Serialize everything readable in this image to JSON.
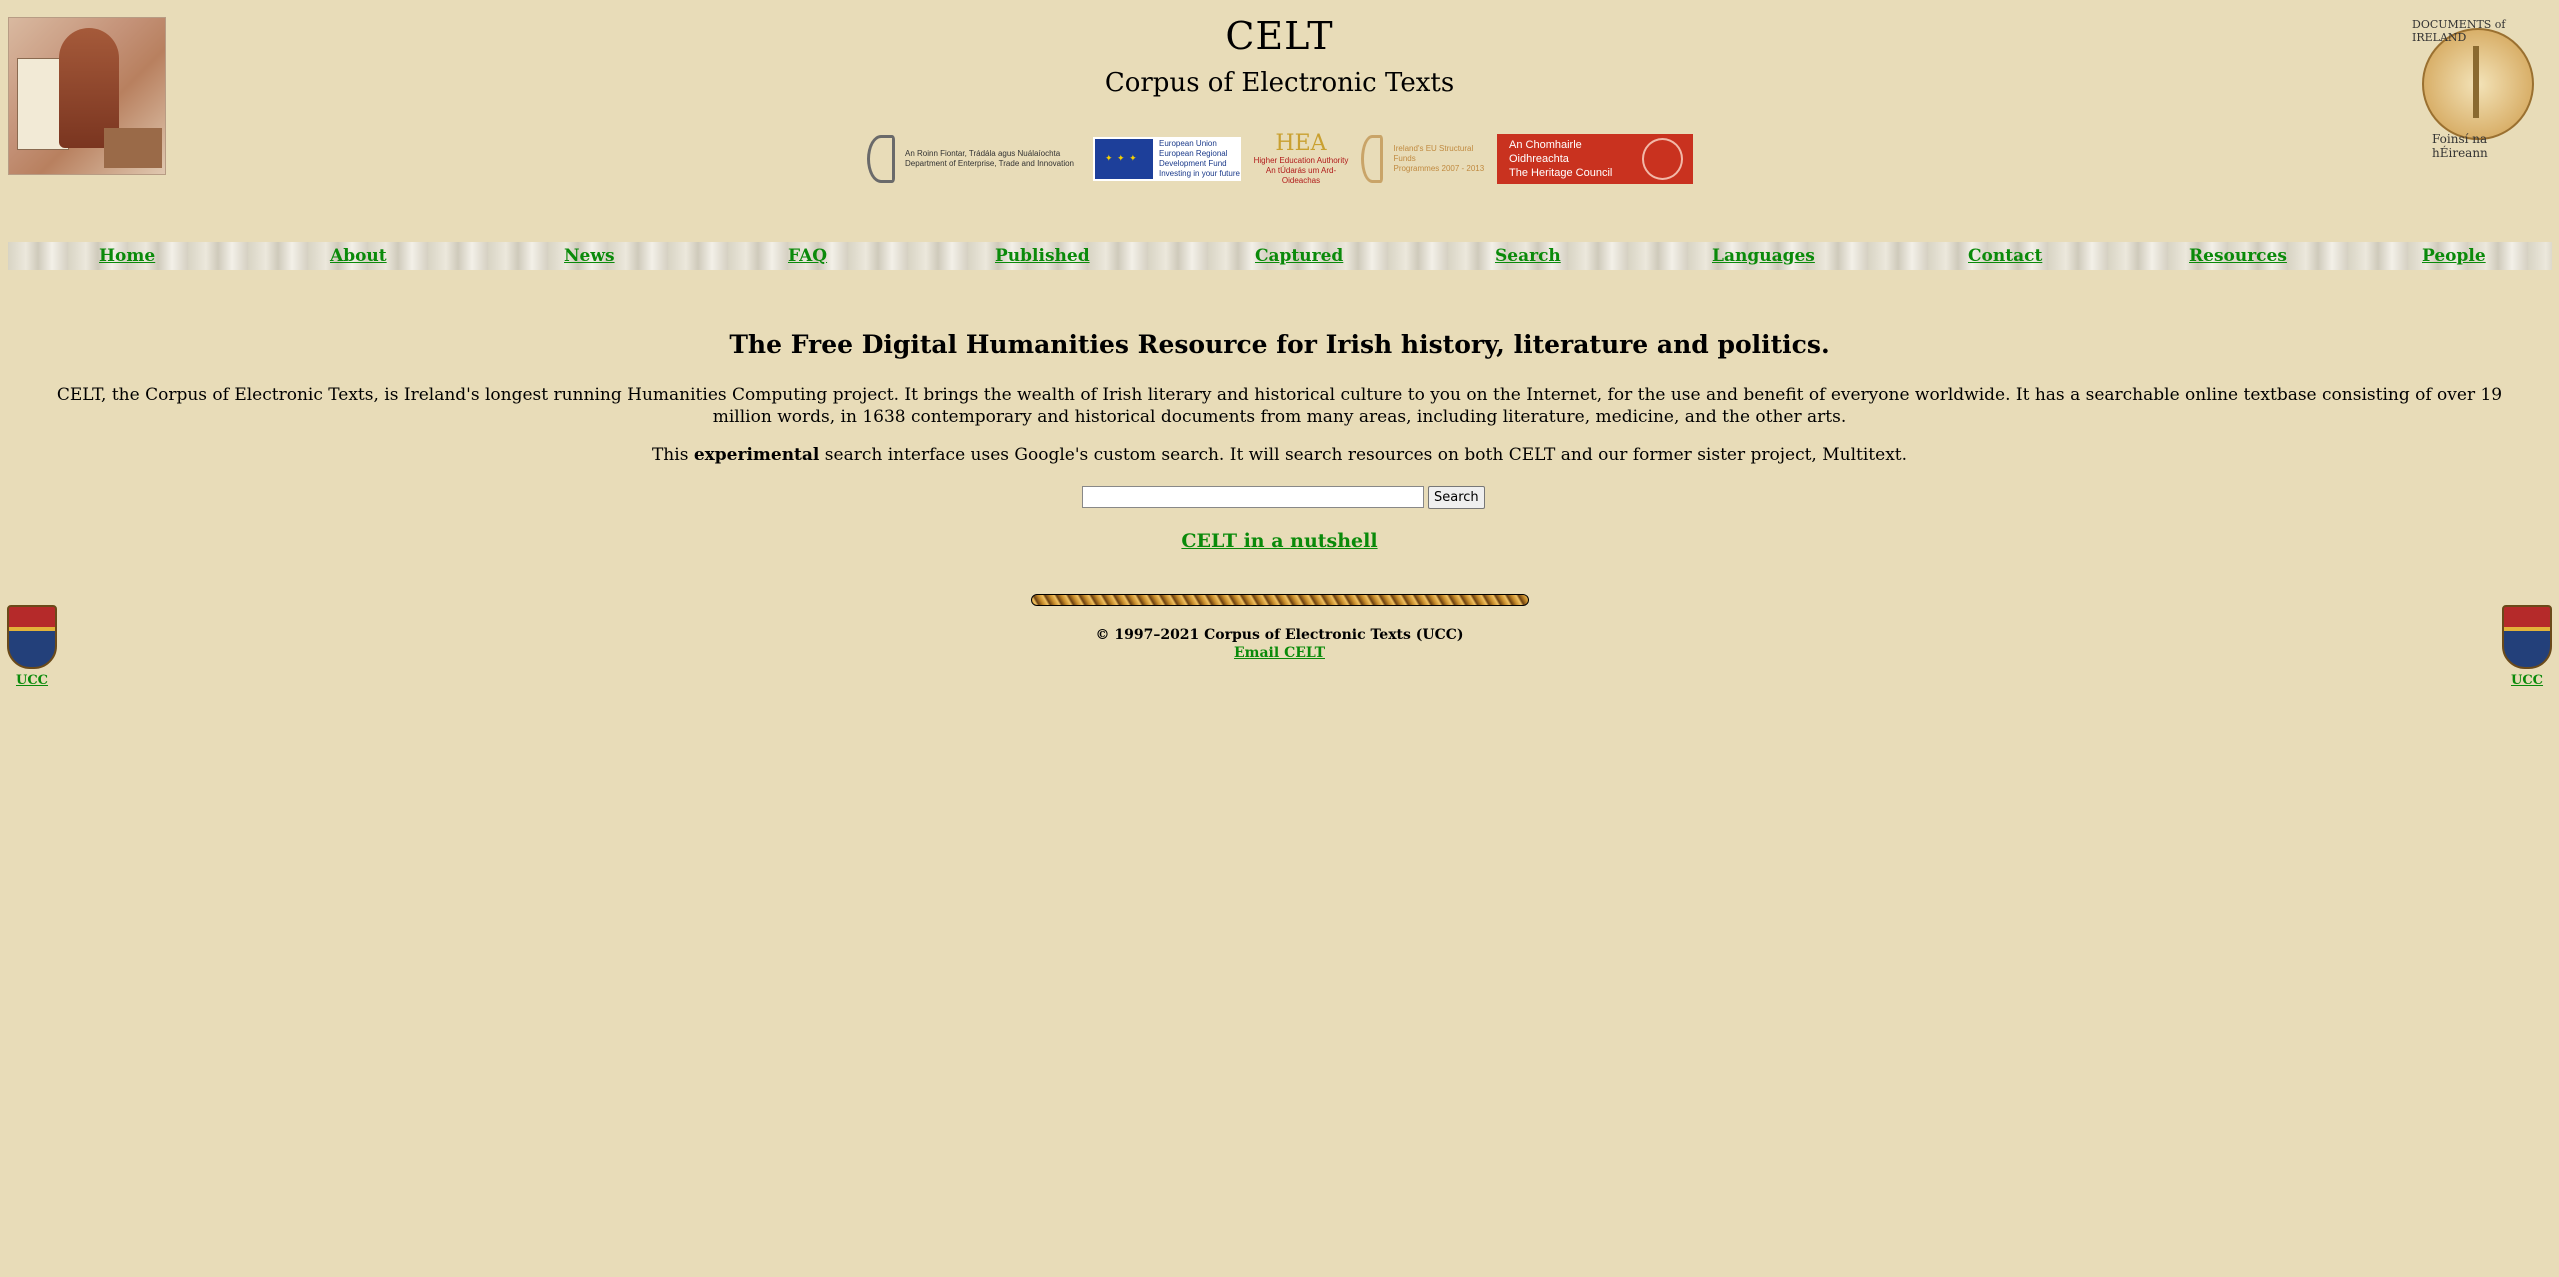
{
  "header": {
    "title": "CELT",
    "subtitle": "Corpus of Electronic Texts",
    "logos": {
      "dept": "An Roinn Fiontar, Trádála agus Nuálaíochta\nDepartment of Enterprise, Trade and Innovation",
      "eu": "European Union\nEuropean Regional\nDevelopment Fund\nInvesting in your future",
      "hea_mark": "HEA",
      "hea": "Higher Education Authority\nAn tÚdarás um Ard-Oideachas",
      "gov": "Ireland's EU Structural Funds\nProgrammes 2007 - 2013",
      "hc": "An Chomhairle Oidhreachta\nThe Heritage Council"
    },
    "doi_top": "DOCUMENTS of IRELAND",
    "doi_bottom": "Foinsí na hÉireann"
  },
  "nav": {
    "items": [
      {
        "label": "Home"
      },
      {
        "label": "About"
      },
      {
        "label": "News"
      },
      {
        "label": "FAQ"
      },
      {
        "label": "Published"
      },
      {
        "label": "Captured"
      },
      {
        "label": "Search"
      },
      {
        "label": "Languages"
      },
      {
        "label": "Contact"
      },
      {
        "label": "Resources"
      },
      {
        "label": "People"
      }
    ]
  },
  "main": {
    "headline": "The Free Digital Humanities Resource for Irish history, literature and politics.",
    "intro": "CELT, the Corpus of Electronic Texts, is Ireland's longest running Humanities Computing project. It brings the wealth of Irish literary and historical culture to you on the Internet, for the use and benefit of everyone worldwide. It has a searchable online textbase consisting of over 19 million words, in 1638 contemporary and historical documents from many areas, including literature, medicine, and the other arts.",
    "exp_prefix": "This ",
    "exp_bold": "experimental",
    "exp_suffix": " search interface uses Google's custom search. It will search resources on both CELT and our former sister project, Multitext.",
    "search_value": "",
    "search_button": "Search",
    "nutshell": "CELT in a nutshell"
  },
  "footer": {
    "copyright": "© 1997–2021 Corpus of Electronic Texts (UCC)",
    "email": "Email CELT",
    "ucc_left": "UCC",
    "ucc_right": "UCC"
  }
}
